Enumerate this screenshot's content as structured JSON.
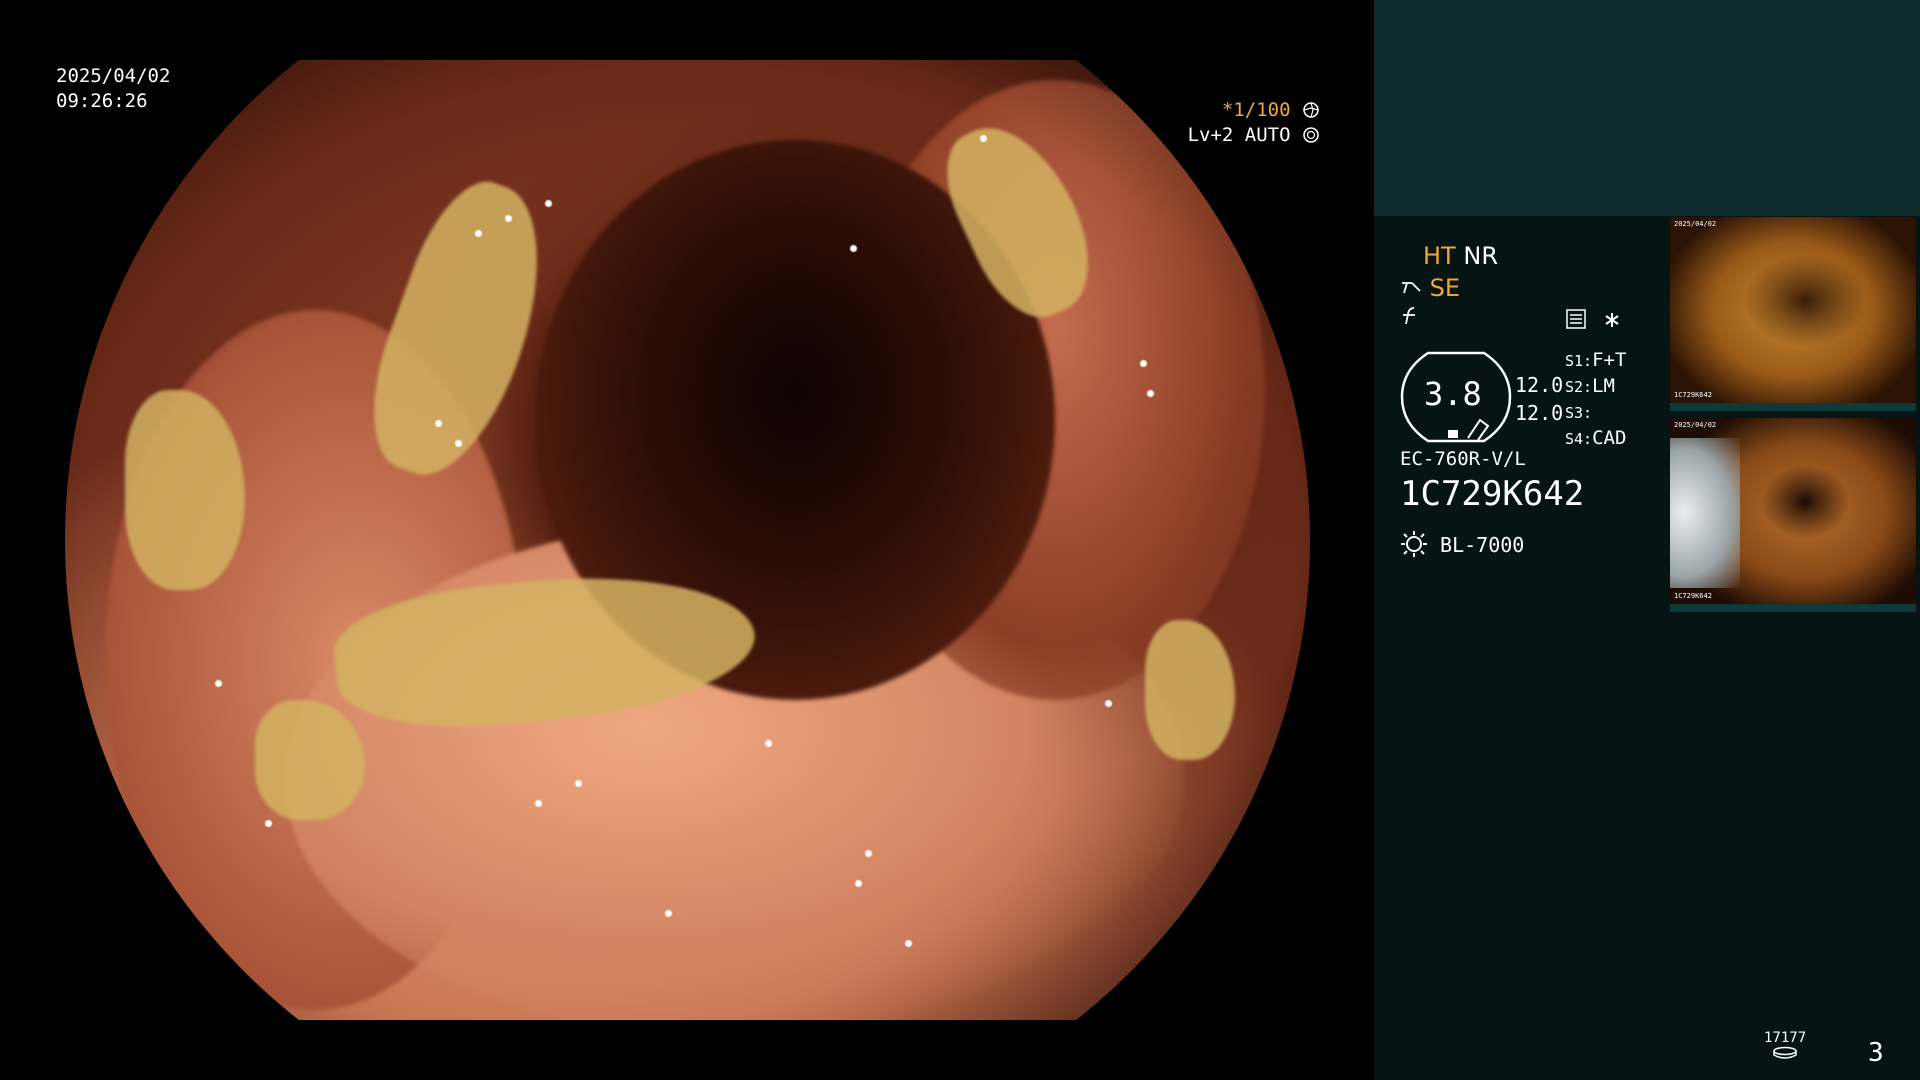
{
  "main_view": {
    "date": "2025/04/02",
    "time": "09:26:26",
    "shutter_speed": "*1/100",
    "level": "Lv+2 AUTO"
  },
  "panel": {
    "ht": "HT",
    "nr": "NR",
    "se": "SE",
    "zoom_value": "3.8",
    "value_a": "12.0",
    "value_b": "12.0",
    "s1_label": "S1:",
    "s1_value": "F+T",
    "s2_label": "S2:",
    "s2_value": "LM",
    "s3_label": "S3:",
    "s3_value": "",
    "s4_label": "S4:",
    "s4_value": "CAD",
    "scope_model": "EC-760R-V/L",
    "serial": "1C729K642",
    "light_source": "BL-7000",
    "storage_count": "17177",
    "capture_count": "3"
  },
  "thumbnails": [
    {
      "date": "2025/04/02",
      "serial": "1C729K642"
    },
    {
      "date": "2025/04/02",
      "serial": "1C729K642"
    }
  ],
  "colors": {
    "accent_orange": "#f0a830",
    "panel_teal": "#0c2a2b",
    "panel_dark": "#061414"
  }
}
